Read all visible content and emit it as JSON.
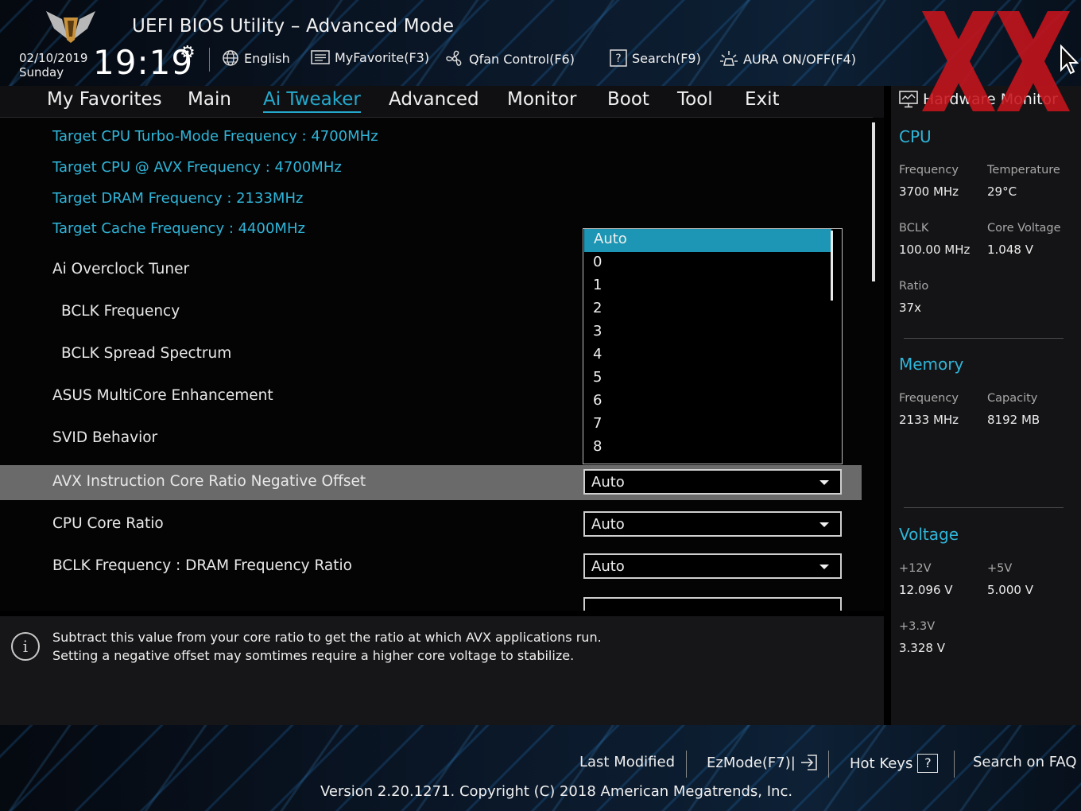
{
  "header": {
    "title": "UEFI BIOS Utility – Advanced Mode",
    "date": "02/10/2019",
    "day": "Sunday",
    "time": "19:19",
    "toolbar": {
      "language": "English",
      "favorite": "MyFavorite(F3)",
      "qfan": "Qfan Control(F6)",
      "search": "Search(F9)",
      "aura": "AURA ON/OFF(F4)"
    }
  },
  "nav": {
    "items": [
      "My Favorites",
      "Main",
      "Ai Tweaker",
      "Advanced",
      "Monitor",
      "Boot",
      "Tool",
      "Exit"
    ],
    "active": "Ai Tweaker"
  },
  "info_lines": [
    "Target CPU Turbo-Mode Frequency : 4700MHz",
    "Target CPU @ AVX Frequency : 4700MHz",
    "Target DRAM Frequency : 2133MHz",
    "Target Cache Frequency : 4400MHz"
  ],
  "settings": [
    {
      "label": "Ai Overclock Tuner"
    },
    {
      "label": "BCLK Frequency"
    },
    {
      "label": "BCLK Spread Spectrum"
    },
    {
      "label": "ASUS MultiCore Enhancement"
    },
    {
      "label": "SVID Behavior"
    },
    {
      "label": "AVX Instruction Core Ratio Negative Offset",
      "value": "Auto"
    },
    {
      "label": "CPU Core Ratio",
      "value": "Auto"
    },
    {
      "label": "BCLK Frequency : DRAM Frequency Ratio",
      "value": "Auto"
    }
  ],
  "open_dropdown": {
    "options": [
      "Auto",
      "0",
      "1",
      "2",
      "3",
      "4",
      "5",
      "6",
      "7",
      "8"
    ],
    "selected": "Auto"
  },
  "help": {
    "line1": "Subtract this value from your core ratio to get the ratio at which AVX applications run.",
    "line2": "Setting a negative offset may somtimes require a higher core voltage to stabilize."
  },
  "hardware_monitor": {
    "title": "Hardware Monitor",
    "cpu": {
      "heading": "CPU",
      "frequency_label": "Frequency",
      "frequency": "3700 MHz",
      "temperature_label": "Temperature",
      "temperature": "29°C",
      "bclk_label": "BCLK",
      "bclk": "100.00 MHz",
      "core_voltage_label": "Core Voltage",
      "core_voltage": "1.048 V",
      "ratio_label": "Ratio",
      "ratio": "37x"
    },
    "memory": {
      "heading": "Memory",
      "frequency_label": "Frequency",
      "frequency": "2133 MHz",
      "capacity_label": "Capacity",
      "capacity": "8192 MB"
    },
    "voltage": {
      "heading": "Voltage",
      "v12_label": "+12V",
      "v12": "12.096 V",
      "v5_label": "+5V",
      "v5": "5.000 V",
      "v33_label": "+3.3V",
      "v33": "3.328 V"
    }
  },
  "footer": {
    "last_modified": "Last Modified",
    "ezmode": "EzMode(F7)|",
    "hotkeys": "Hot Keys",
    "hotkeys_key": "?",
    "search_faq": "Search on FAQ",
    "version": "Version 2.20.1271. Copyright (C) 2018 American Megatrends, Inc."
  },
  "colors": {
    "accent": "#24a9cd",
    "selected_row": "#6a6a6a",
    "selected_option": "#1c96b4",
    "watermark": "#c8141c"
  }
}
